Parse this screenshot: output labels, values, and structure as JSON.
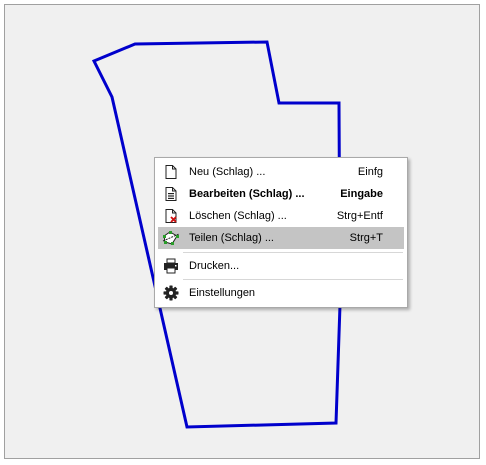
{
  "map": {
    "polygon_color": "#0000cc"
  },
  "context_menu": {
    "items": [
      {
        "label": "Neu (Schlag) ...",
        "shortcut": "Einfg",
        "icon": "new-document-icon",
        "bold": false,
        "highlighted": false
      },
      {
        "label": "Bearbeiten (Schlag) ...",
        "shortcut": "Eingabe",
        "icon": "edit-document-icon",
        "bold": true,
        "highlighted": false
      },
      {
        "label": "Löschen (Schlag) ...",
        "shortcut": "Strg+Entf",
        "icon": "delete-document-icon",
        "bold": false,
        "highlighted": false
      },
      {
        "label": "Teilen (Schlag) ...",
        "shortcut": "Strg+T",
        "icon": "split-polygon-icon",
        "bold": false,
        "highlighted": true
      },
      {
        "label": "Drucken...",
        "shortcut": "",
        "icon": "printer-icon",
        "bold": false,
        "highlighted": false
      },
      {
        "label": "Einstellungen",
        "shortcut": "",
        "icon": "gear-icon",
        "bold": false,
        "highlighted": false
      }
    ],
    "highlight_color": "#c4c4c4"
  }
}
